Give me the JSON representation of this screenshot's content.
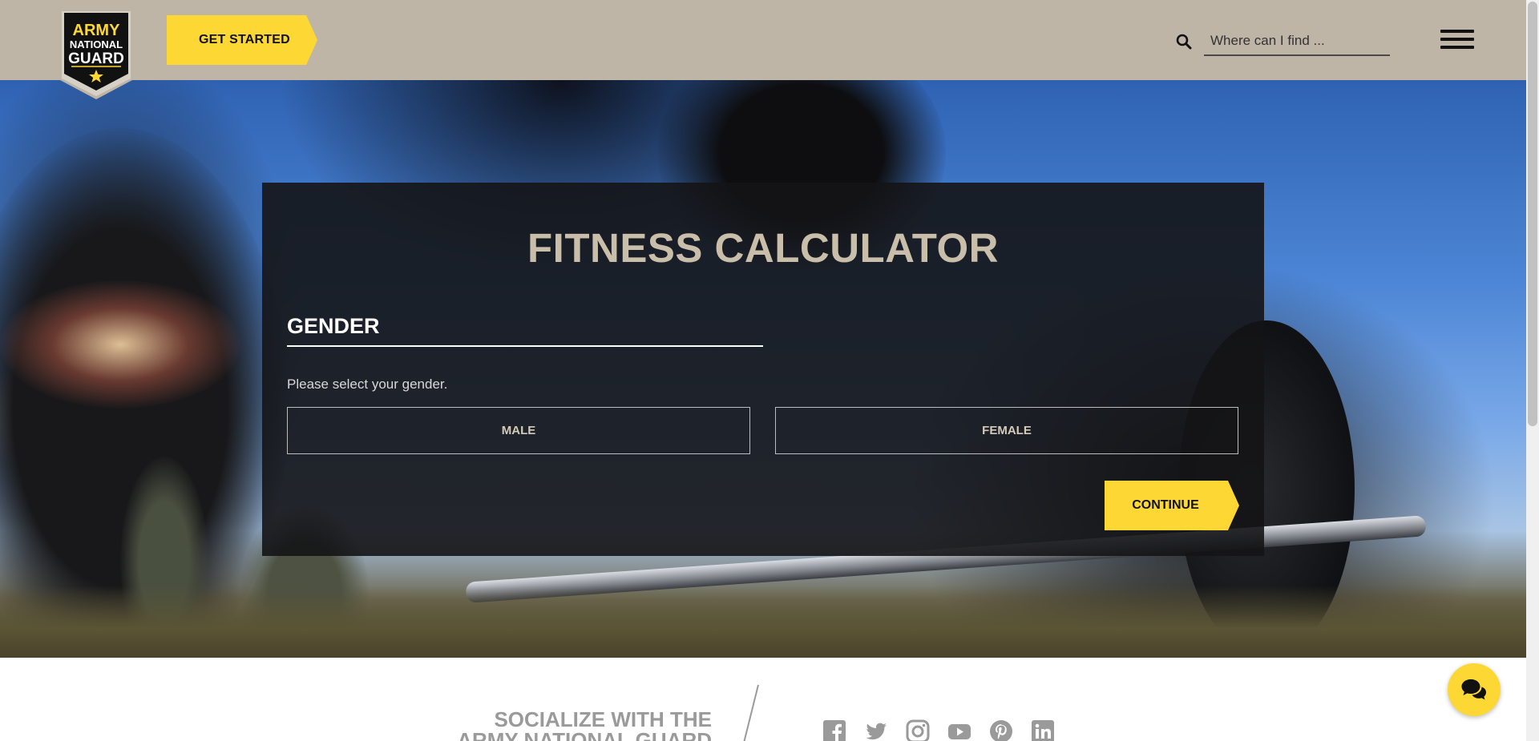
{
  "header": {
    "logo": {
      "line1": "ARMY",
      "line2": "NATIONAL",
      "line3": "GUARD"
    },
    "get_started_label": "GET STARTED",
    "search": {
      "placeholder": "Where can I find ...",
      "value": ""
    },
    "icons": {
      "search": "search-icon",
      "menu": "hamburger-menu-icon"
    }
  },
  "calculator": {
    "title": "FITNESS CALCULATOR",
    "section_title": "GENDER",
    "description": "Please select your gender.",
    "options": [
      {
        "label": "MALE"
      },
      {
        "label": "FEMALE"
      }
    ],
    "continue_label": "CONTINUE"
  },
  "social": {
    "heading_line1": "SOCIALIZE WITH THE",
    "heading_line2": "ARMY NATIONAL GUARD",
    "icons": [
      "facebook-icon",
      "twitter-icon",
      "instagram-icon",
      "youtube-icon",
      "pinterest-icon",
      "linkedin-icon"
    ]
  },
  "chat": {
    "icon": "chat-bubbles-icon"
  },
  "colors": {
    "header_bg": "#bfb5a6",
    "accent_yellow": "#fdd835",
    "card_bg": "#141416",
    "title_tan": "#c9bea9",
    "social_gray": "#9a9a9a"
  }
}
